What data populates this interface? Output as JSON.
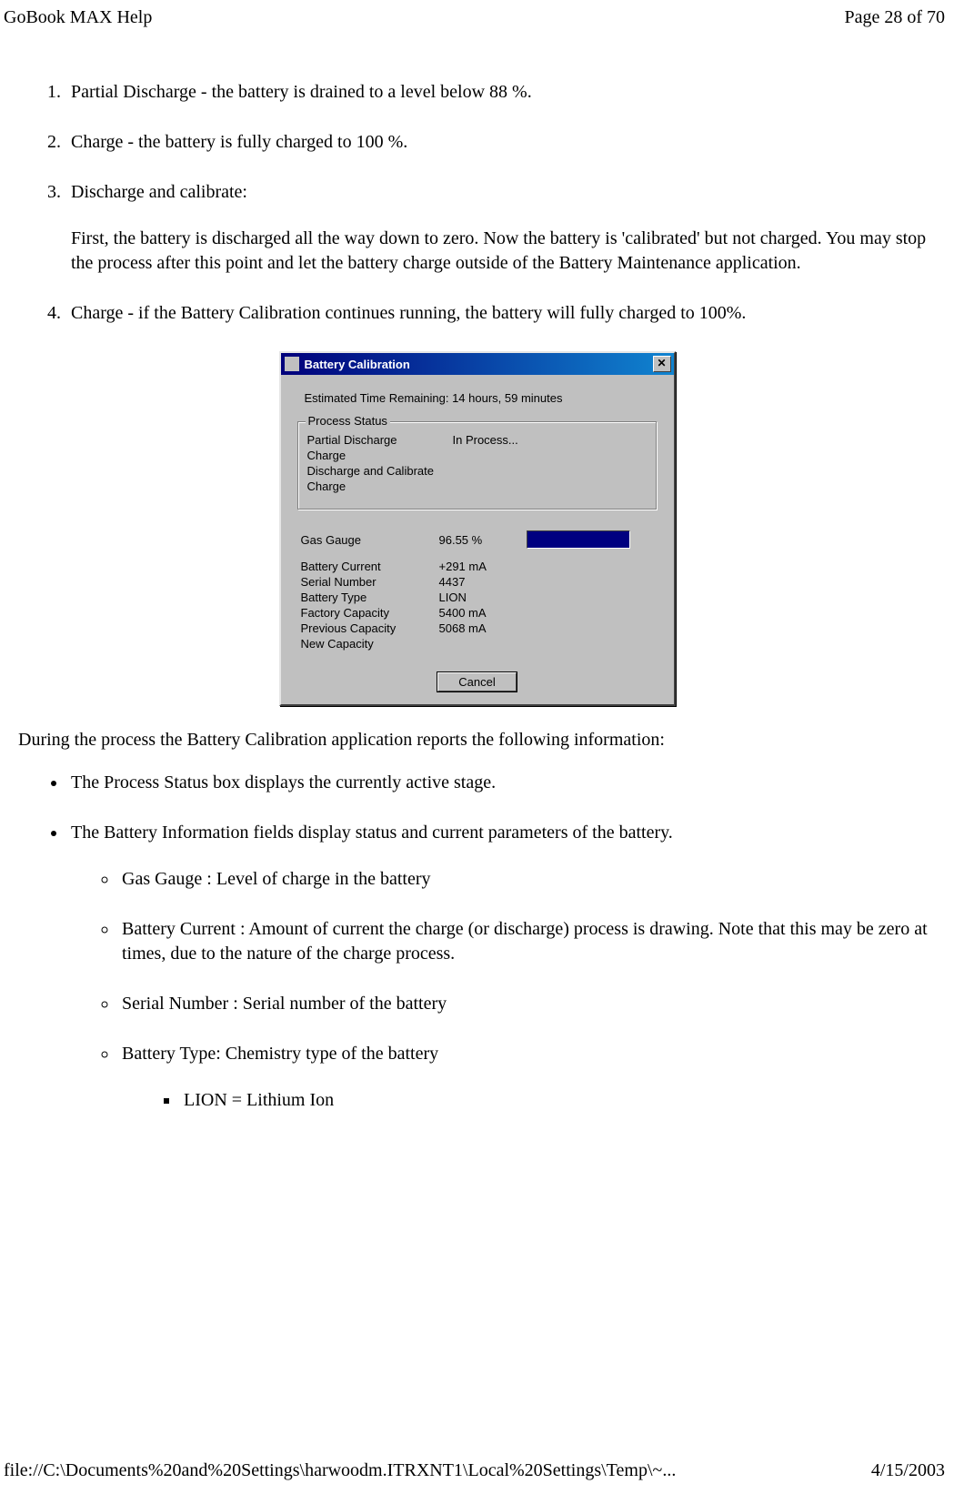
{
  "header": {
    "title": "GoBook MAX Help",
    "page_label": "Page 28 of 70"
  },
  "footer": {
    "path": "file://C:\\Documents%20and%20Settings\\harwoodm.ITRXNT1\\Local%20Settings\\Temp\\~...",
    "date": "4/15/2003"
  },
  "steps": {
    "s1": " Partial Discharge - the battery is drained to a level below 88 %.",
    "s2": " Charge - the battery is fully charged to 100 %.",
    "s3_title": " Discharge and calibrate:",
    "s3_body": "First, the battery is discharged all the way down to zero.  Now the battery is 'calibrated' but not charged. You may stop the process after this point and let the battery charge outside of the Battery Maintenance application.",
    "s4": "Charge - if the Battery Calibration continues running, the battery will fully charged to 100%."
  },
  "after_fig": "During the process the Battery Calibration application reports the following information:",
  "bullets": {
    "b1": "The Process Status box displays the currently active stage.",
    "b2": "The Battery Information fields display status and current parameters of the battery.",
    "sub": {
      "gas": "Gas Gauge : Level of charge in the battery",
      "cur": "Battery Current : Amount of current the charge (or discharge) process is drawing. Note that this may be zero at times, due to the nature of the charge process.",
      "sn": "Serial Number : Serial number of the battery",
      "bt": "Battery Type: Chemistry type of the battery",
      "lion": "LION = Lithium Ion"
    }
  },
  "dialog": {
    "title": "Battery Calibration",
    "close_glyph": "✕",
    "estimated": "Estimated Time Remaining:  14 hours, 59 minutes",
    "group_legend": "Process Status",
    "rows": {
      "r1l": "Partial Discharge",
      "r1r": "In Process...",
      "r2l": "Charge",
      "r3l": "Discharge and Calibrate",
      "r4l": "Charge"
    },
    "info": {
      "gas_l": "Gas Gauge",
      "gas_v": "96.55 %",
      "cur_l": "Battery Current",
      "cur_v": "+291 mA",
      "sn_l": "Serial Number",
      "sn_v": "4437",
      "bt_l": "Battery Type",
      "bt_v": "LION",
      "fc_l": "Factory Capacity",
      "fc_v": "5400 mA",
      "pc_l": "Previous Capacity",
      "pc_v": "5068 mA",
      "nc_l": "New Capacity",
      "nc_v": ""
    },
    "cancel": "Cancel"
  }
}
